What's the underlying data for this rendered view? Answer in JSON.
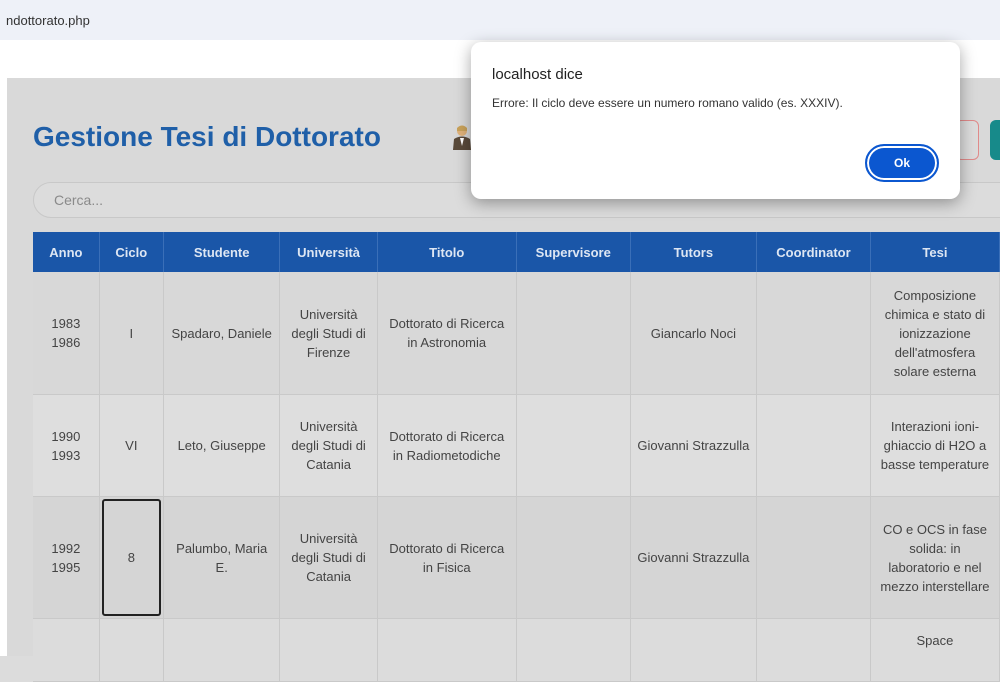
{
  "browser": {
    "url": "ndottorato.php"
  },
  "page": {
    "title": "Gestione Tesi di Dottorato",
    "search_placeholder": "Cerca..."
  },
  "table": {
    "columns": [
      "Anno",
      "Ciclo",
      "Studente",
      "Università",
      "Titolo",
      "Supervisore",
      "Tutors",
      "Coordinator",
      "Tesi"
    ],
    "rows": [
      {
        "anno_start": "1983",
        "anno_end": "1986",
        "ciclo": "I",
        "studente": "Spadaro, Daniele",
        "universita": "Università degli Studi di Firenze",
        "titolo": "Dottorato di Ricerca in Astronomia",
        "supervisore": "",
        "tutors": "Giancarlo Noci",
        "coordinator": "",
        "tesi": "Composizione chimica e stato di ionizzazione dell'atmosfera solare esterna"
      },
      {
        "anno_start": "1990",
        "anno_end": "1993",
        "ciclo": "VI",
        "studente": "Leto, Giuseppe",
        "universita": "Università degli Studi di Catania",
        "titolo": "Dottorato di Ricerca in Radiometodiche",
        "supervisore": "",
        "tutors": "Giovanni Strazzulla",
        "coordinator": "",
        "tesi": "Interazioni ioni-ghiaccio di H2O a basse temperature"
      },
      {
        "anno_start": "1992",
        "anno_end": "1995",
        "ciclo": "8",
        "studente": "Palumbo, Maria E.",
        "universita": "Università degli Studi di Catania",
        "titolo": "Dottorato di Ricerca in Fisica",
        "supervisore": "",
        "tutors": "Giovanni Strazzulla",
        "coordinator": "",
        "tesi": "CO e OCS in fase solida: in laboratorio e nel mezzo interstellare"
      },
      {
        "anno_start": "",
        "anno_end": "",
        "ciclo": "",
        "studente": "",
        "universita": "",
        "titolo": "",
        "supervisore": "",
        "tutors": "",
        "coordinator": "",
        "tesi": "Space"
      }
    ]
  },
  "dialog": {
    "title": "localhost dice",
    "message": "Errore: Il ciclo deve essere un numero romano valido (es. XXXIV).",
    "ok_label": "Ok"
  },
  "colors": {
    "header_bg": "#1a56a8",
    "title": "#1f5fa8",
    "ok_button": "#0b57d0",
    "teal_button": "#178a8a"
  }
}
